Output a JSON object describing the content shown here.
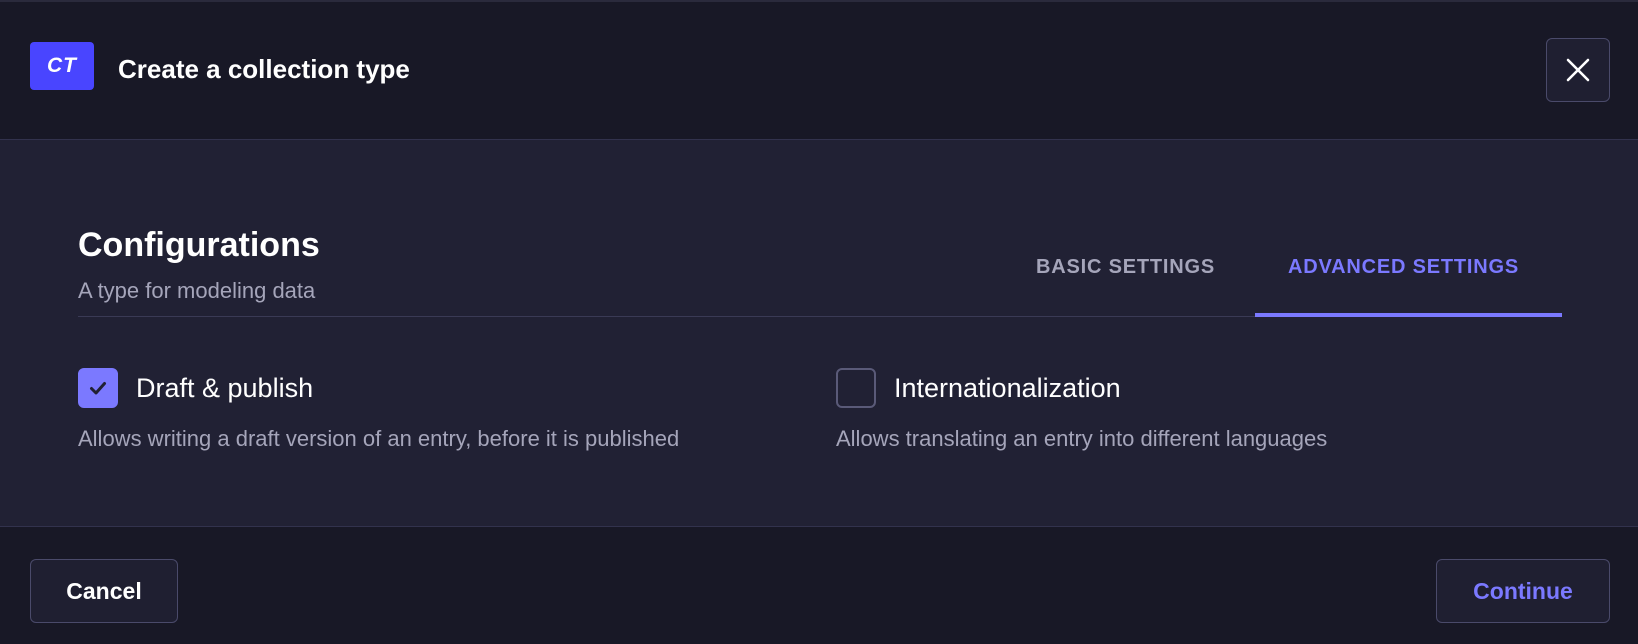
{
  "header": {
    "badge": "CT",
    "title": "Create a collection type",
    "close_icon": "close-icon"
  },
  "section": {
    "title": "Configurations",
    "subtitle": "A type for modeling data"
  },
  "tabs": [
    {
      "label": "BASIC SETTINGS",
      "active": false
    },
    {
      "label": "ADVANCED SETTINGS",
      "active": true
    }
  ],
  "options": [
    {
      "label": "Draft & publish",
      "description": "Allows writing a draft version of an entry, before it is published",
      "checked": true
    },
    {
      "label": "Internationalization",
      "description": "Allows translating an entry into different languages",
      "checked": false
    }
  ],
  "footer": {
    "cancel_label": "Cancel",
    "continue_label": "Continue"
  },
  "colors": {
    "accent": "#7b79ff",
    "badge": "#4945ff",
    "background": "#181826",
    "body": "#212134"
  }
}
